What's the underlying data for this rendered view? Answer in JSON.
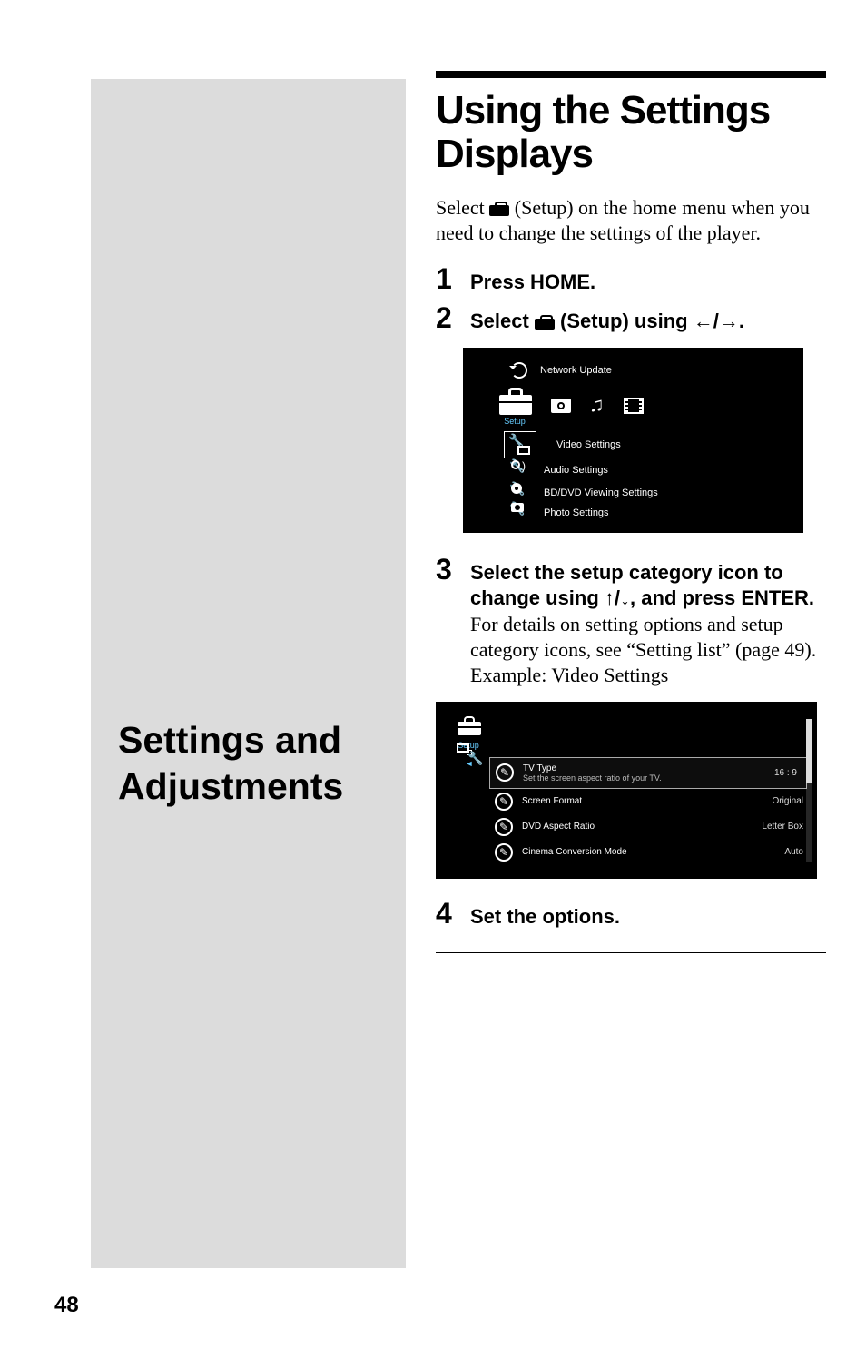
{
  "page_number": "48",
  "left_panel": {
    "title_line1": "Settings and",
    "title_line2": "Adjustments"
  },
  "main": {
    "title_line1": "Using the Settings",
    "title_line2": "Displays",
    "lead_part1": "Select ",
    "lead_part2": " (Setup) on the home menu when you need to change the settings of the player.",
    "steps": {
      "s1": {
        "num": "1",
        "label": "Press HOME."
      },
      "s2": {
        "num": "2",
        "label_part1": "Select ",
        "label_part2": " (Setup) using ",
        "label_arrows": "←/→",
        "label_part3": "."
      },
      "s3": {
        "num": "3",
        "label_part1": "Select the setup category icon to change using ",
        "label_arrows": "↑/↓",
        "label_part2": ", and press ENTER.",
        "desc_line1": "For details on setting options and setup category icons, see “Setting list” (page 49).",
        "desc_line2": "Example: Video Settings"
      },
      "s4": {
        "num": "4",
        "label": "Set the options."
      }
    }
  },
  "screenshot1": {
    "setup_label": "Setup",
    "items": {
      "network_update": "Network Update",
      "video_settings": "Video Settings",
      "audio_settings": "Audio Settings",
      "bd_dvd_viewing": "BD/DVD Viewing Settings",
      "photo_settings": "Photo Settings"
    }
  },
  "screenshot2": {
    "setup_label": "Setup",
    "rows": [
      {
        "label": "TV Type",
        "sub": "Set the screen aspect ratio of your TV.",
        "value": "16 : 9",
        "selected": true
      },
      {
        "label": "Screen Format",
        "sub": "",
        "value": "Original",
        "selected": false
      },
      {
        "label": "DVD Aspect Ratio",
        "sub": "",
        "value": "Letter Box",
        "selected": false
      },
      {
        "label": "Cinema Conversion Mode",
        "sub": "",
        "value": "Auto",
        "selected": false
      }
    ]
  }
}
